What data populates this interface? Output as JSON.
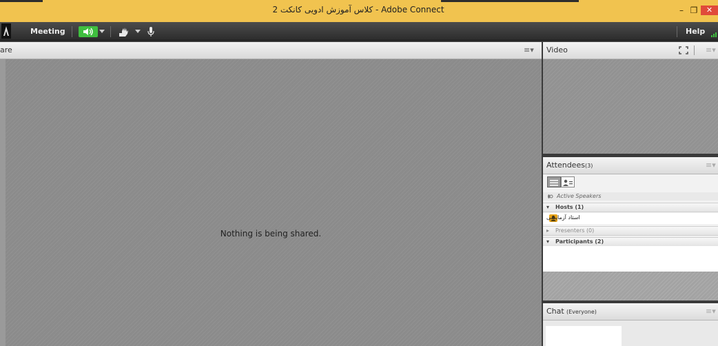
{
  "window": {
    "title": "کلاس آموزش ادویی کانکت 2 - Adobe Connect",
    "minimize": "–",
    "restore": "❐",
    "close": "✕"
  },
  "menubar": {
    "meeting": "Meeting",
    "help": "Help"
  },
  "share_pod": {
    "title": "are",
    "message": "Nothing is being shared.",
    "menu_icon": "≡▾"
  },
  "video_pod": {
    "title": "Video",
    "menu_icon": "≡▾"
  },
  "attendees_pod": {
    "title": "Attendees",
    "count": "(3)",
    "menu_icon": "≡▾",
    "active_speakers": "Active Speakers",
    "hosts": "Hosts (1)",
    "host_name": "استاد آزمایشی",
    "presenters": "Presenters (0)",
    "participants": "Participants (2)"
  },
  "chat_pod": {
    "title": "Chat",
    "scope": "(Everyone)",
    "menu_icon": "≡▾"
  },
  "colors": {
    "titlebar": "#f1c34f",
    "accent_green": "#3fbf3f",
    "close_red": "#e04a3a"
  }
}
